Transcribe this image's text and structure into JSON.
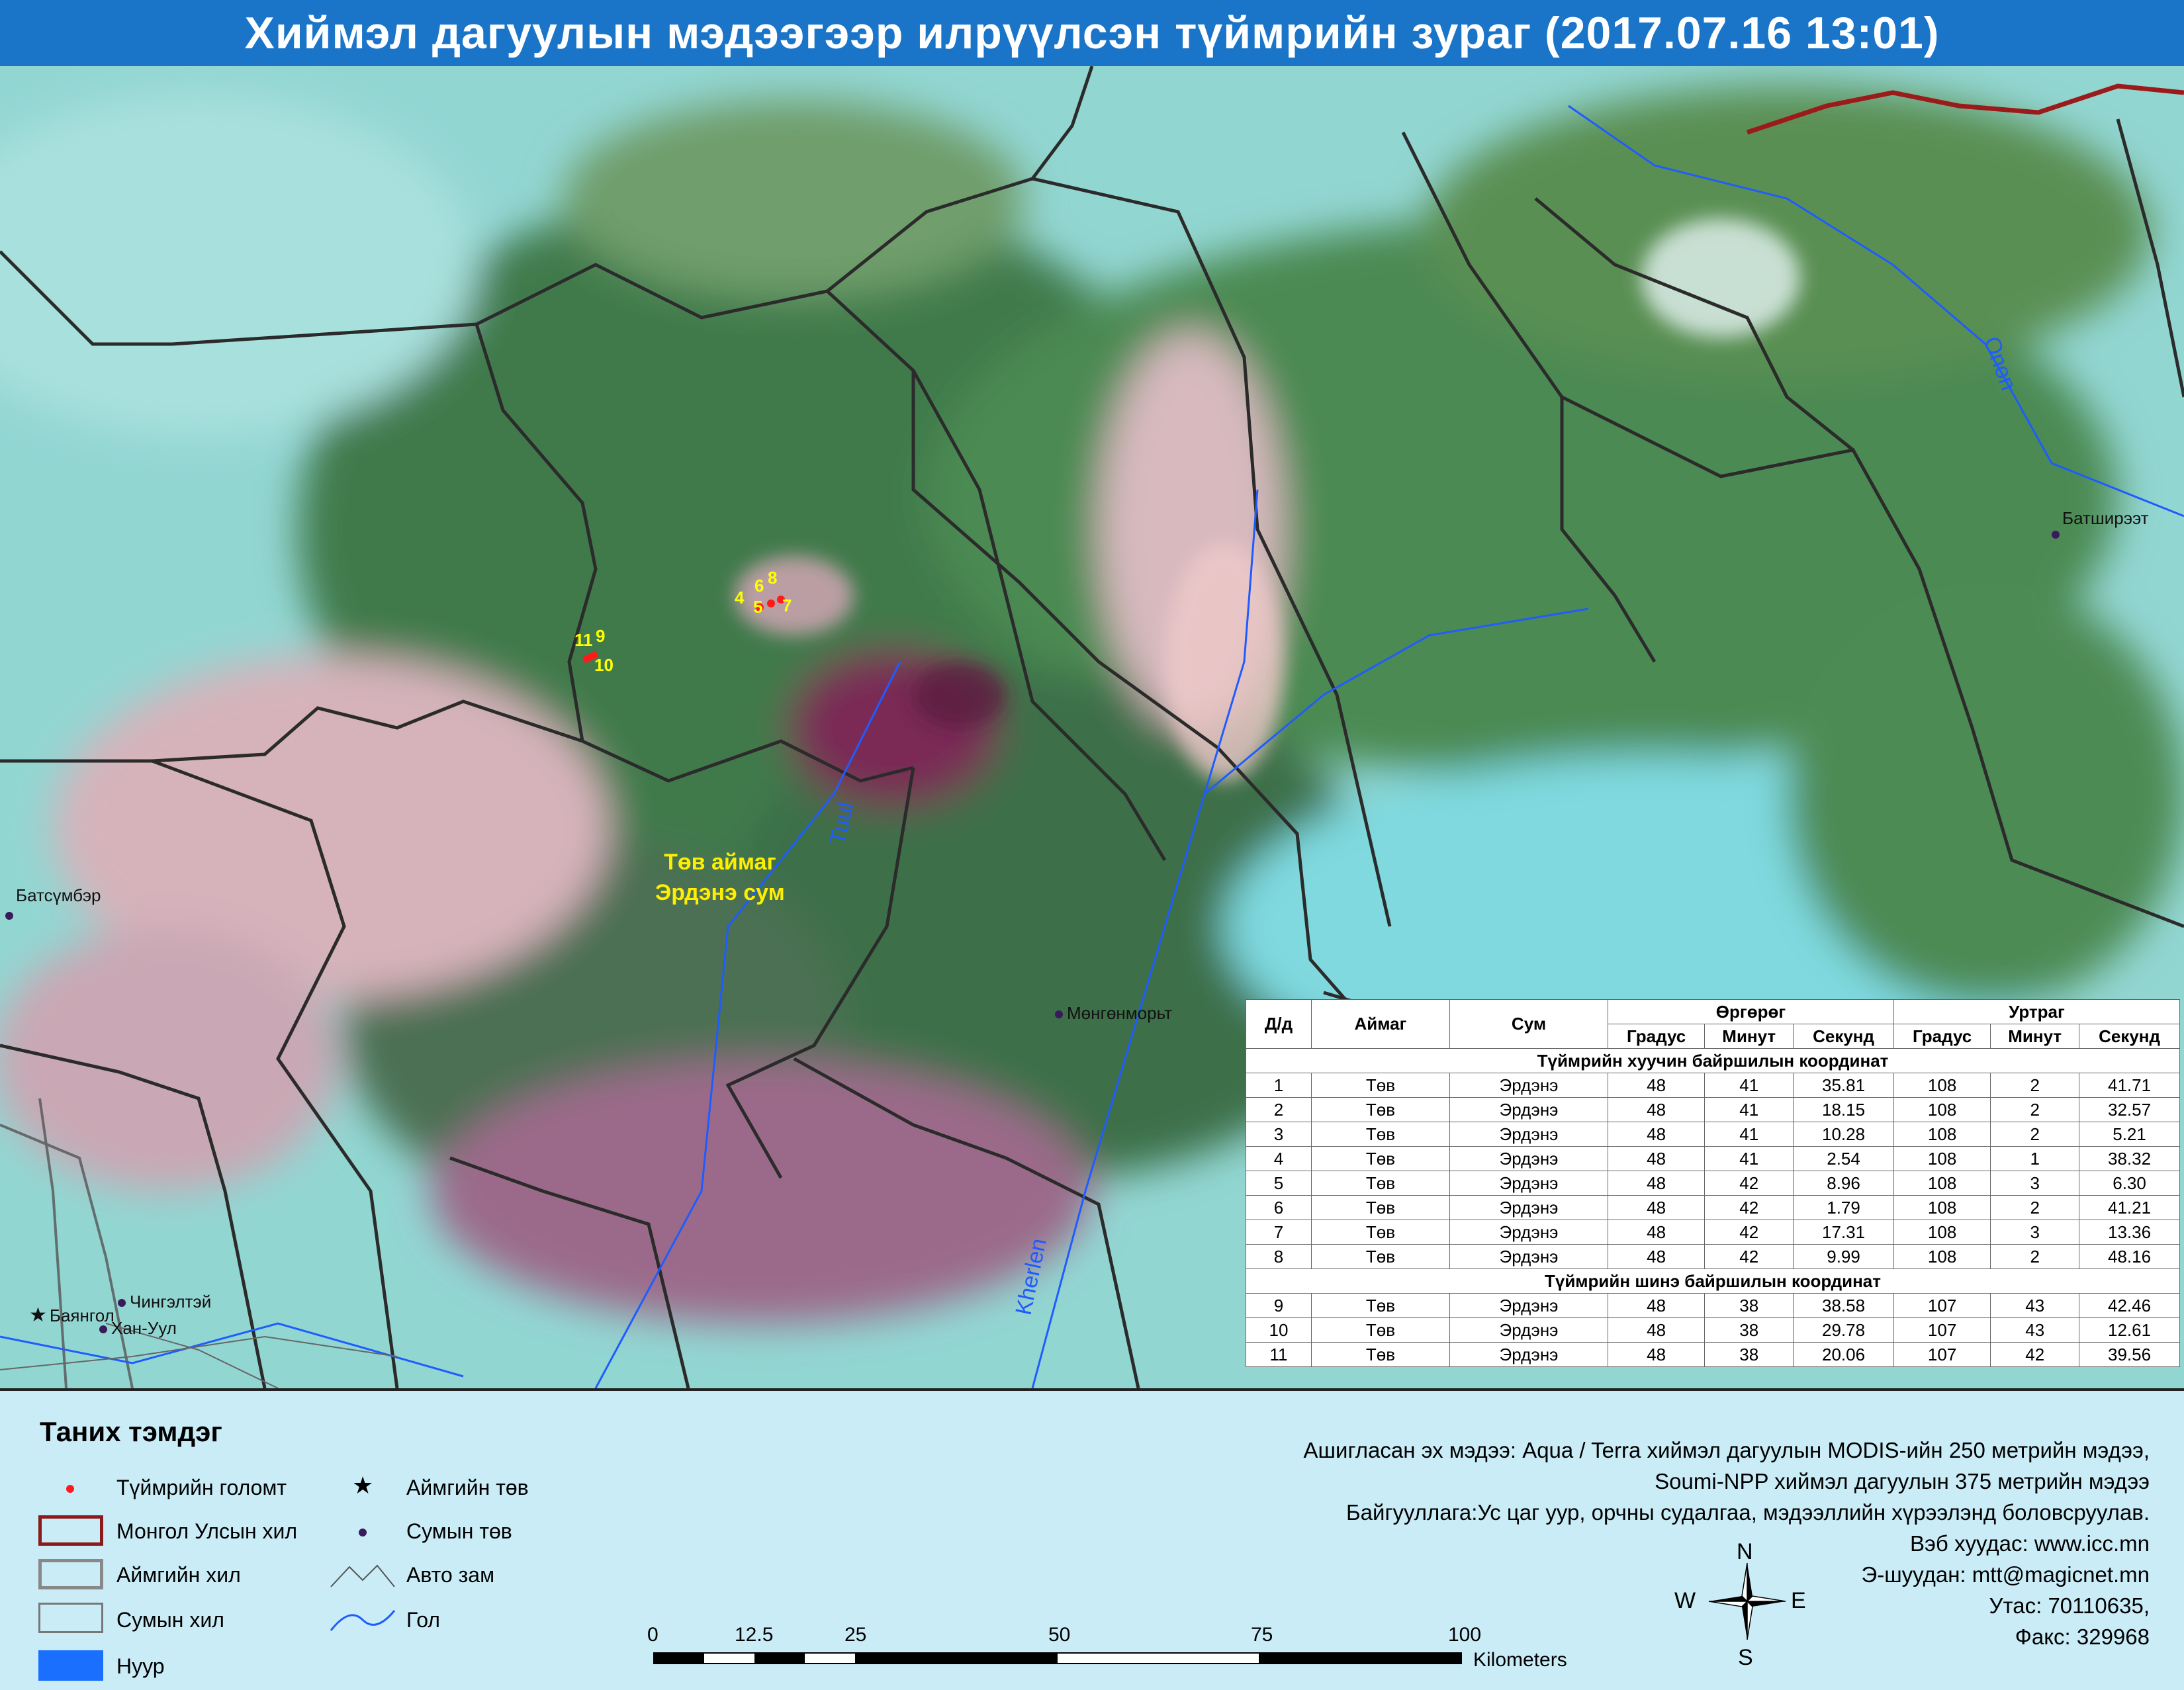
{
  "title": "Хиймэл дагуулын мэдээгээр илрүүлсэн түймрийн зураг  (2017.07.16  13:01)",
  "map": {
    "places": {
      "batsumber": "Батсүмбэр",
      "batshireet": "Батширээт",
      "mungunmorit": "Мөнгөнморьт",
      "chingeltei": "Чингэлтэй",
      "bayangol": "Баянгол",
      "khan_uul": "Хан-Уул"
    },
    "area_label_line1": "Төв аймаг",
    "area_label_line2": "Эрдэнэ сум",
    "rivers": {
      "tuul": "Tuul",
      "onon": "Onon",
      "kherlen": "Kherlen"
    },
    "fire_numbers": [
      "4",
      "5",
      "6",
      "8",
      "7",
      "11",
      "9",
      "10"
    ]
  },
  "table": {
    "headers": {
      "dd": "Д/д",
      "aimag": "Аймаг",
      "sum": "Сум",
      "latitude": "Өргөрөг",
      "longitude": "Уртраг",
      "deg": "Градус",
      "min": "Минут",
      "sec": "Секунд"
    },
    "section_old": "Түймрийн хуучин байршилын координат",
    "section_new": "Түймрийн шинэ байршилын координат",
    "old_rows": [
      [
        "1",
        "Төв",
        "Эрдэнэ",
        "48",
        "41",
        "35.81",
        "108",
        "2",
        "41.71"
      ],
      [
        "2",
        "Төв",
        "Эрдэнэ",
        "48",
        "41",
        "18.15",
        "108",
        "2",
        "32.57"
      ],
      [
        "3",
        "Төв",
        "Эрдэнэ",
        "48",
        "41",
        "10.28",
        "108",
        "2",
        "5.21"
      ],
      [
        "4",
        "Төв",
        "Эрдэнэ",
        "48",
        "41",
        "2.54",
        "108",
        "1",
        "38.32"
      ],
      [
        "5",
        "Төв",
        "Эрдэнэ",
        "48",
        "42",
        "8.96",
        "108",
        "3",
        "6.30"
      ],
      [
        "6",
        "Төв",
        "Эрдэнэ",
        "48",
        "42",
        "1.79",
        "108",
        "2",
        "41.21"
      ],
      [
        "7",
        "Төв",
        "Эрдэнэ",
        "48",
        "42",
        "17.31",
        "108",
        "3",
        "13.36"
      ],
      [
        "8",
        "Төв",
        "Эрдэнэ",
        "48",
        "42",
        "9.99",
        "108",
        "2",
        "48.16"
      ]
    ],
    "new_rows": [
      [
        "9",
        "Төв",
        "Эрдэнэ",
        "48",
        "38",
        "38.58",
        "107",
        "43",
        "42.46"
      ],
      [
        "10",
        "Төв",
        "Эрдэнэ",
        "48",
        "38",
        "29.78",
        "107",
        "43",
        "12.61"
      ],
      [
        "11",
        "Төв",
        "Эрдэнэ",
        "48",
        "38",
        "20.06",
        "107",
        "42",
        "39.56"
      ]
    ]
  },
  "legend": {
    "title": "Таних тэмдэг",
    "fire": "Түймрийн голомт",
    "national_border": "Монгол Улсын хил",
    "aimag_border": "Аймгийн хил",
    "sum_border": "Сумын хил",
    "lake": "Нуур",
    "aimag_center": "Аймгийн төв",
    "sum_center": "Сумын төв",
    "road": "Авто зам",
    "river": "Гол"
  },
  "scale": {
    "ticks": [
      "0",
      "12.5",
      "25",
      "50",
      "75",
      "100"
    ],
    "unit": "Kilometers"
  },
  "compass": {
    "n": "N",
    "s": "S",
    "e": "E",
    "w": "W"
  },
  "info": {
    "line1": "Ашигласан эх мэдээ: Aqua / Terra хиймэл дагуулын MODIS-ийн 250 метрийн мэдээ,",
    "line2": "Soumi-NPP хиймэл дагуулын 375 метрийн мэдээ",
    "line3": "Байгууллага:Ус цаг уур, орчны судалгаа, мэдээллийн хүрээлэнд боловсруулав.",
    "line4": "Вэб хуудас: www.icc.mn",
    "line5": "Э-шуудан: mtt@magicnet.mn",
    "line6": "Утас: 70110635,",
    "line7": "Факс: 329968"
  },
  "colors": {
    "title_bg": "#1a75c9",
    "fire_dot": "#ff1a1a",
    "fire_label": "#ffff00",
    "national_border": "#9b1b1b",
    "river": "#1f5cff",
    "legend_bg": "#c9ecf7",
    "lake": "#1a6fff"
  }
}
